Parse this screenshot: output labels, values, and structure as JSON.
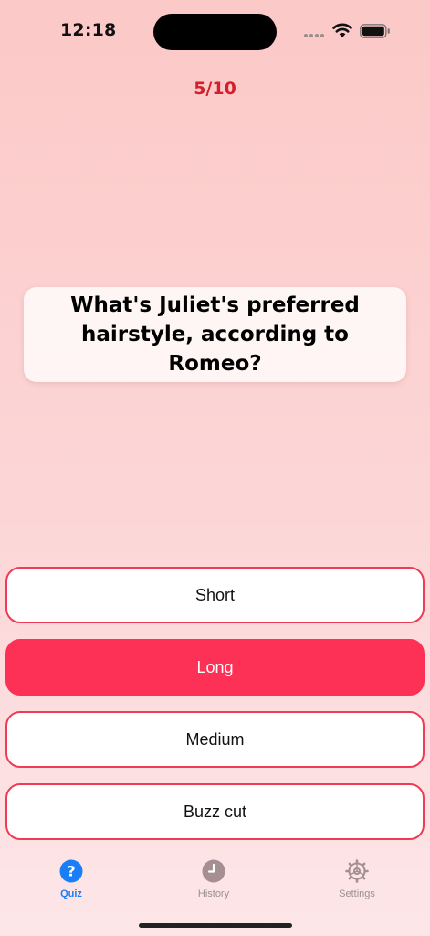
{
  "status_bar": {
    "time": "12:18"
  },
  "progress": {
    "label": "5/10",
    "current": 5,
    "total": 10
  },
  "question": {
    "text": "What's Juliet's preferred hairstyle, according to Romeo?"
  },
  "answers": [
    {
      "label": "Short",
      "selected": false
    },
    {
      "label": "Long",
      "selected": true
    },
    {
      "label": "Medium",
      "selected": false
    },
    {
      "label": "Buzz cut",
      "selected": false
    }
  ],
  "tabs": [
    {
      "label": "Quiz",
      "icon": "question-circle-icon",
      "active": true
    },
    {
      "label": "History",
      "icon": "clock-icon",
      "active": false
    },
    {
      "label": "Settings",
      "icon": "gear-icon",
      "active": false
    }
  ],
  "colors": {
    "accent": "#fd3155",
    "progress": "#d21f2a",
    "tab_active": "#1a7ef7",
    "tab_inactive": "#9a8f8f"
  }
}
